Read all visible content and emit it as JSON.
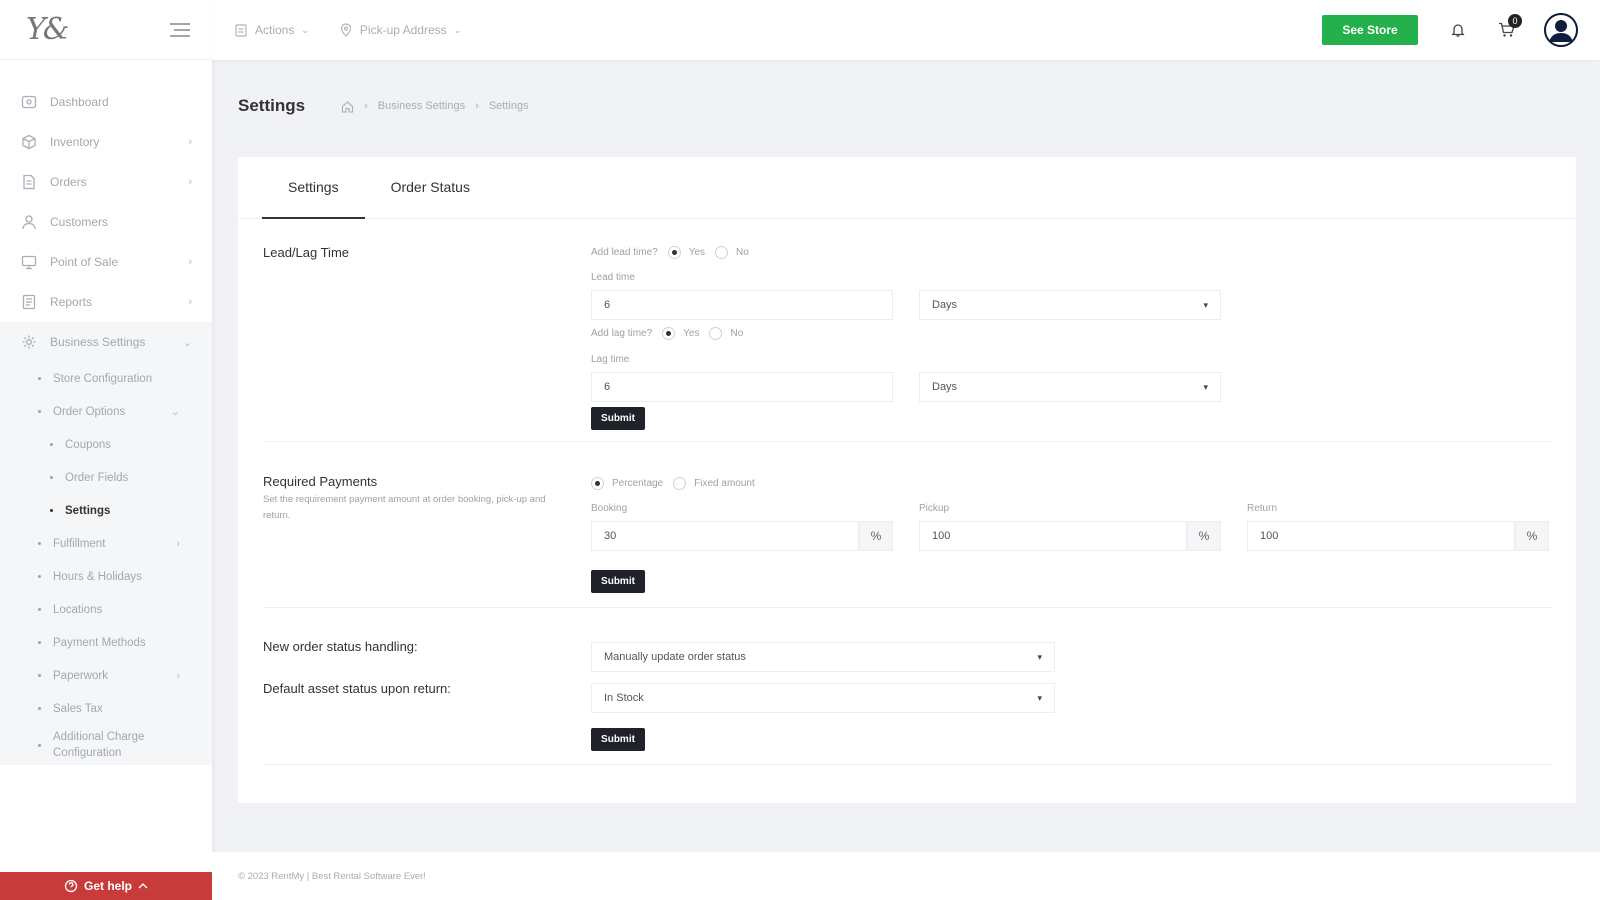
{
  "brand": {
    "logo_text": "Y&"
  },
  "topbar": {
    "actions_label": "Actions",
    "pickup_label": "Pick-up Address",
    "see_store_label": "See Store",
    "cart_count": "0"
  },
  "sidebar": {
    "items": [
      {
        "label": "Dashboard"
      },
      {
        "label": "Inventory"
      },
      {
        "label": "Orders"
      },
      {
        "label": "Customers"
      },
      {
        "label": "Point of Sale"
      },
      {
        "label": "Reports"
      },
      {
        "label": "Business Settings"
      }
    ],
    "sub_items": [
      {
        "label": "Store Configuration"
      },
      {
        "label": "Order Options"
      },
      {
        "label": "Coupons"
      },
      {
        "label": "Order Fields"
      },
      {
        "label": "Settings"
      },
      {
        "label": "Fulfillment"
      },
      {
        "label": "Hours & Holidays"
      },
      {
        "label": "Locations"
      },
      {
        "label": "Payment Methods"
      },
      {
        "label": "Paperwork"
      },
      {
        "label": "Sales Tax"
      },
      {
        "label": "Additional Charge Configuration"
      }
    ],
    "help_label": "Get help"
  },
  "page": {
    "title": "Settings",
    "breadcrumb": [
      "Business Settings",
      "Settings"
    ]
  },
  "tabs": [
    {
      "label": "Settings"
    },
    {
      "label": "Order Status"
    }
  ],
  "leadlag": {
    "title": "Lead/Lag Time",
    "add_lead_label": "Add lead time?",
    "yes_label": "Yes",
    "no_label": "No",
    "lead_time_label": "Lead time",
    "lead_time_value": "6",
    "lead_unit": "Days",
    "add_lag_label": "Add lag time?",
    "lag_time_label": "Lag time",
    "lag_time_value": "6",
    "lag_unit": "Days",
    "submit_label": "Submit"
  },
  "payments": {
    "title": "Required Payments",
    "description": "Set the requirement payment amount at order booking, pick-up and return.",
    "percentage_label": "Percentage",
    "fixed_label": "Fixed amount",
    "booking_label": "Booking",
    "booking_value": "30",
    "pickup_label": "Pickup",
    "pickup_value": "100",
    "return_label": "Return",
    "return_value": "100",
    "pct_symbol": "%",
    "submit_label": "Submit"
  },
  "status_handling": {
    "new_order_label": "New order status handling:",
    "new_order_value": "Manually update order status",
    "default_asset_label": "Default asset status upon return:",
    "default_asset_value": "In Stock",
    "submit_label": "Submit"
  },
  "footer": {
    "text": "© 2023 RentMy | Best Rental Software Ever!"
  }
}
